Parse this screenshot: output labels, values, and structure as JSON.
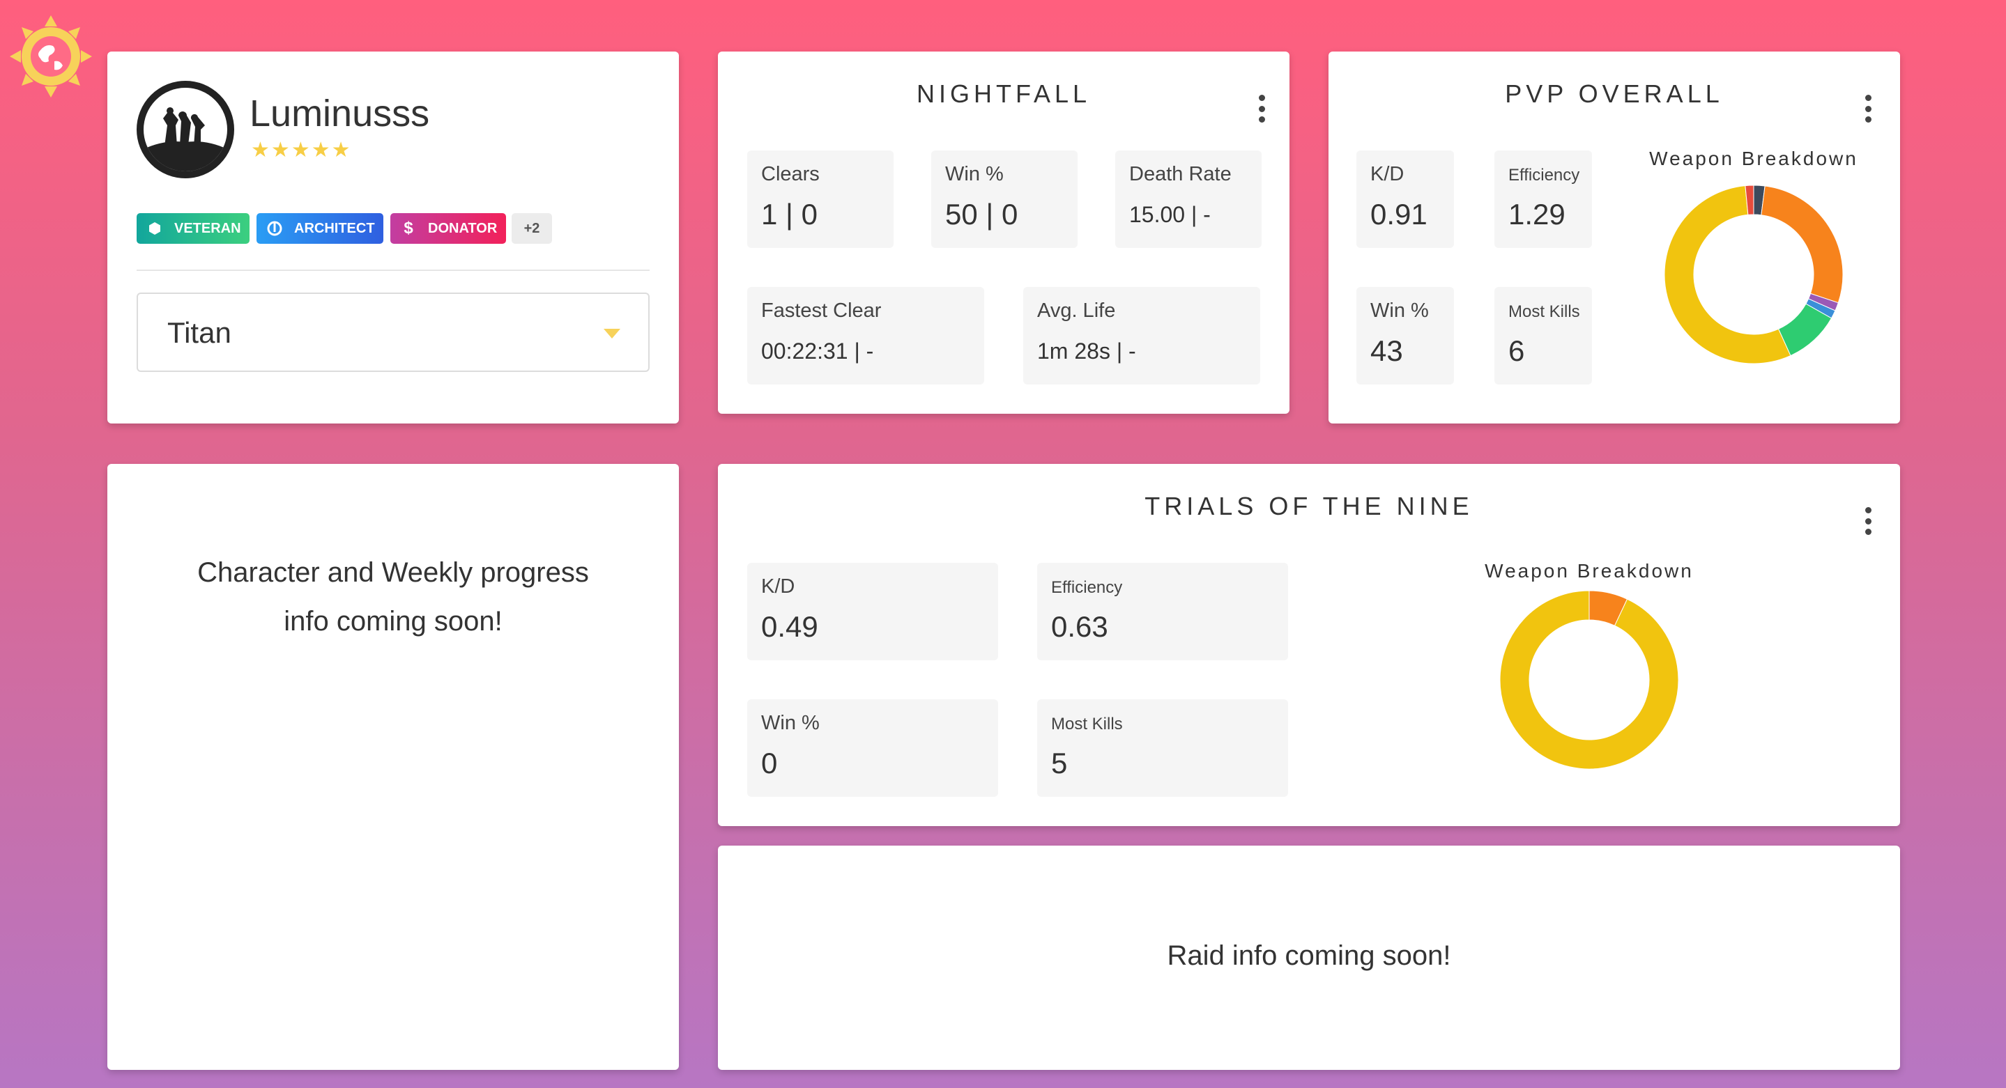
{
  "app": {
    "logo_icon": "sun-globe-icon"
  },
  "profile": {
    "name": "Luminusss",
    "rating_stars": 5,
    "badges": [
      {
        "label": "VETERAN",
        "icon": "hexagon-icon",
        "color": "#21b5a6"
      },
      {
        "label": "ARCHITECT",
        "icon": "rebel-icon",
        "color": "#2f7fe6"
      },
      {
        "label": "DONATOR",
        "icon": "dollar-icon",
        "color": "#d2307a"
      }
    ],
    "more_badges": "+2",
    "character_select": {
      "value": "Titan"
    }
  },
  "nightfall": {
    "title": "NIGHTFALL",
    "clears_label": "Clears",
    "clears_value": "1 | 0",
    "win_label": "Win %",
    "win_value": "50 | 0",
    "death_label": "Death Rate",
    "death_value": "15.00 | -",
    "fastest_label": "Fastest Clear",
    "fastest_value": "00:22:31 | -",
    "life_label": "Avg. Life",
    "life_value": "1m 28s | -"
  },
  "pvp": {
    "title": "PVP OVERALL",
    "kd_label": "K/D",
    "kd_value": "0.91",
    "eff_label": "Efficiency",
    "eff_value": "1.29",
    "win_label": "Win %",
    "win_value": "43",
    "kills_label": "Most Kills",
    "kills_value": "6",
    "breakdown_label": "Weapon Breakdown"
  },
  "trials": {
    "title": "TRIALS OF THE NINE",
    "kd_label": "K/D",
    "kd_value": "0.49",
    "eff_label": "Efficiency",
    "eff_value": "0.63",
    "win_label": "Win %",
    "win_value": "0",
    "kills_label": "Most Kills",
    "kills_value": "5",
    "breakdown_label": "Weapon Breakdown"
  },
  "character_info": {
    "text_line1": "Character and Weekly progress",
    "text_line2": "info coming soon!"
  },
  "raid_info": {
    "text": "Raid info coming soon!"
  },
  "chart_data": [
    {
      "type": "pie",
      "series": [
        {
          "values": [
            2,
            28,
            1.5,
            1.5,
            10,
            55,
            1.5
          ],
          "colors": [
            "#3d4a5c",
            "#f7831c",
            "#9b59b6",
            "#3a8fd8",
            "#2ecc71",
            "#f1c40f",
            "#e74c3c"
          ]
        }
      ]
    },
    {
      "type": "pie",
      "series": [
        {
          "values": [
            7,
            93
          ],
          "colors": [
            "#f7831c",
            "#f1c40f"
          ]
        }
      ]
    }
  ]
}
